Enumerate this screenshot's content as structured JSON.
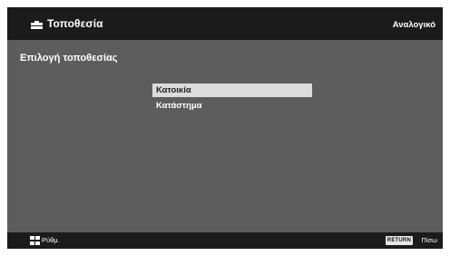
{
  "header": {
    "icon": "toolbox-icon",
    "title": "Τοποθεσία",
    "mode": "Αναλογικό"
  },
  "section": {
    "title": "Επιλογή τοποθεσίας"
  },
  "menu": {
    "selected_index": 0,
    "items": [
      {
        "label": "Κατοικία"
      },
      {
        "label": "Κατάστημα"
      }
    ]
  },
  "footer": {
    "options_icon": "options-icon",
    "options_label": "Ρύθμ.",
    "return_key": "RETURN",
    "return_label": "Πίσω"
  },
  "colors": {
    "screen_background": "#5d5d5d",
    "bars": "#1b1b1b",
    "highlight": "#dcdcdc"
  }
}
